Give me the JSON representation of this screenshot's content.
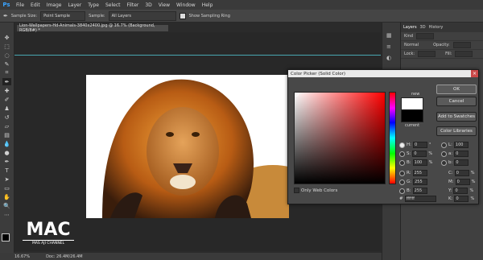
{
  "app": {
    "logo": "Ps"
  },
  "menubar": [
    "File",
    "Edit",
    "Image",
    "Layer",
    "Type",
    "Select",
    "Filter",
    "3D",
    "View",
    "Window",
    "Help"
  ],
  "options": {
    "sample_size_label": "Sample Size:",
    "sample_size_value": "Point Sample",
    "sample_label": "Sample:",
    "sample_value": "All Layers",
    "sampling_ring_label": "Show Sampling Ring"
  },
  "document": {
    "tab_title": "Lion-Wallpapers-Hd-Animals-3840x2400.jpg @ 16.7% (Background, RGB/8#) *"
  },
  "status": {
    "zoom": "16.67%",
    "doc": "Doc: 26.4M/26.4M"
  },
  "panel": {
    "tabs": [
      "Layers",
      "3D",
      "History"
    ],
    "kind_label": "Kind",
    "normal_label": "Normal",
    "opacity_label": "Opacity:",
    "lock_label": "Lock:",
    "fill_label": "Fill:"
  },
  "color_picker": {
    "title": "Color Picker (Solid Color)",
    "new_label": "new",
    "current_label": "current",
    "ok": "OK",
    "cancel": "Cancel",
    "add_swatches": "Add to Swatches",
    "color_libraries": "Color Libraries",
    "only_web_colors": "Only Web Colors",
    "fields": {
      "H": {
        "value": "0",
        "unit": "°"
      },
      "S": {
        "value": "0",
        "unit": "%"
      },
      "B": {
        "value": "100",
        "unit": "%"
      },
      "R": {
        "value": "255",
        "unit": ""
      },
      "G": {
        "value": "255",
        "unit": ""
      },
      "Bl": {
        "value": "255",
        "unit": ""
      },
      "L": {
        "value": "100",
        "unit": ""
      },
      "a": {
        "value": "0",
        "unit": ""
      },
      "b": {
        "value": "0",
        "unit": ""
      },
      "C": {
        "value": "0",
        "unit": "%"
      },
      "M": {
        "value": "0",
        "unit": "%"
      },
      "Y": {
        "value": "0",
        "unit": "%"
      },
      "K": {
        "value": "0",
        "unit": "%"
      },
      "hex": "ffffff"
    },
    "new_color": "#ffffff",
    "current_color": "#000000"
  },
  "watermark": {
    "title": "MAC",
    "subtitle": "MAS AJI CHANNEL"
  }
}
